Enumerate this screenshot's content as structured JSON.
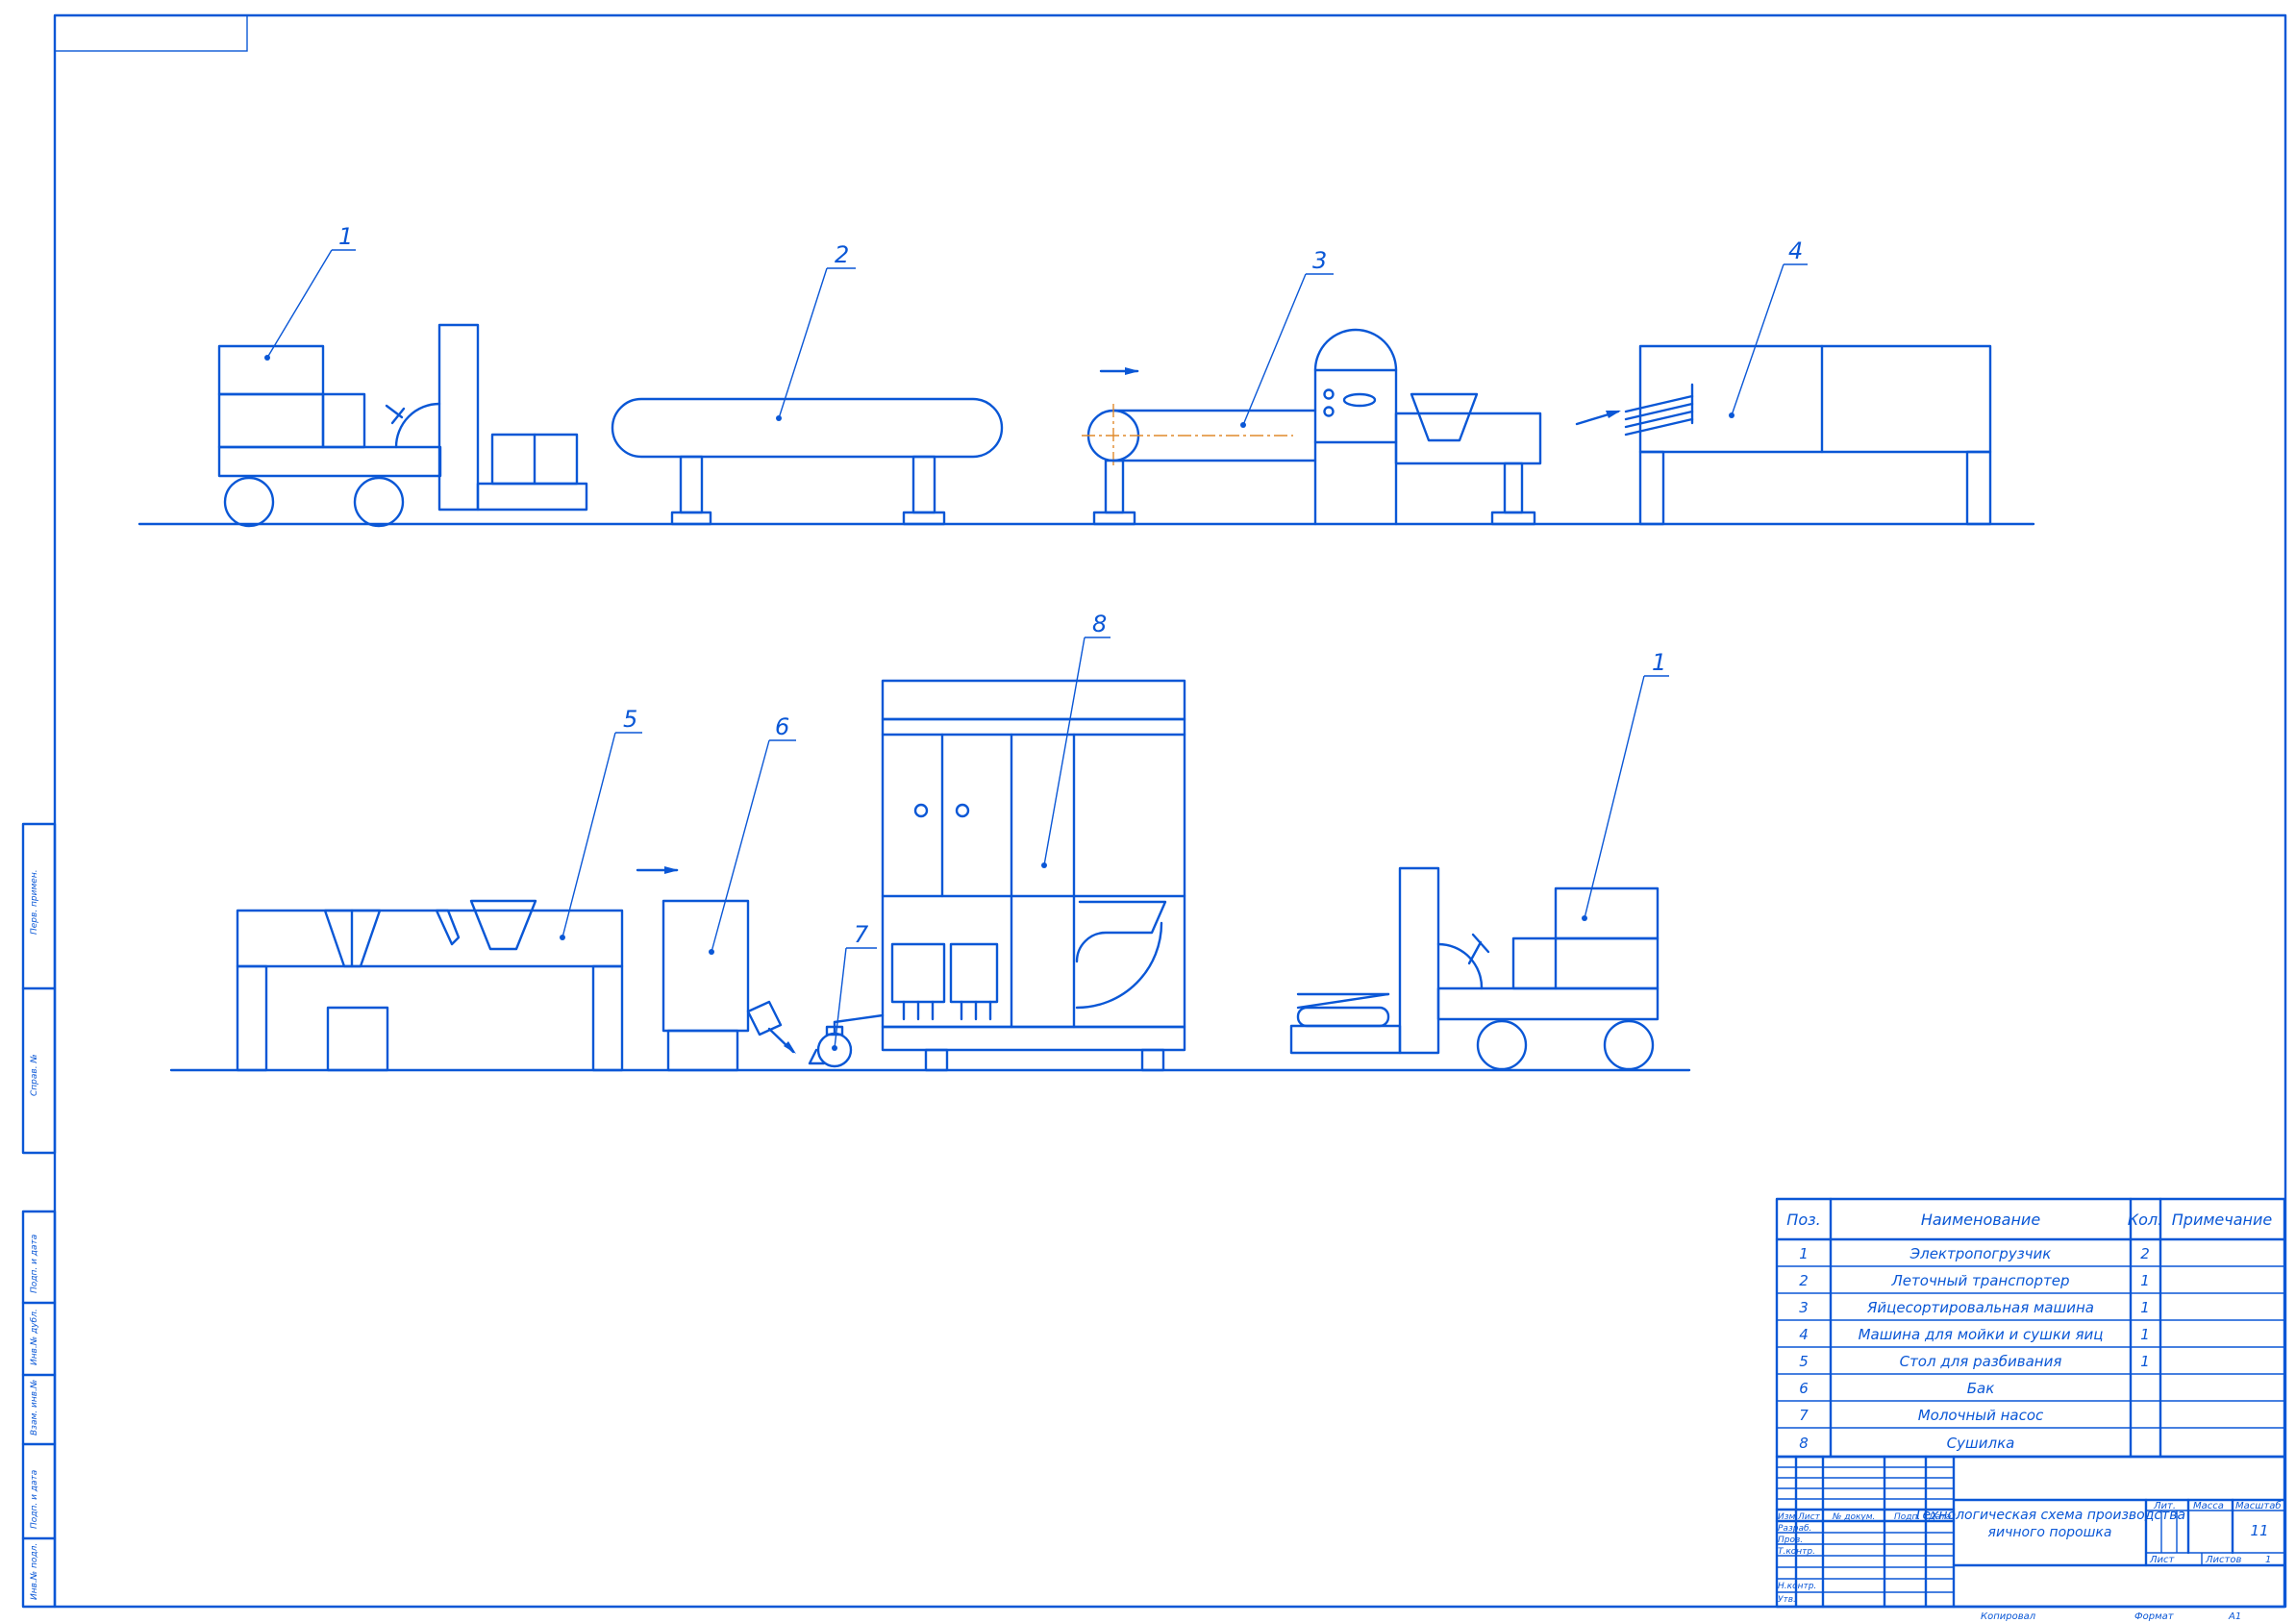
{
  "positions": [
    "1",
    "2",
    "3",
    "4",
    "5",
    "6",
    "7",
    "8"
  ],
  "spec": {
    "headers": {
      "pos": "Поз.",
      "name": "Наименование",
      "qty": "Кол.",
      "note": "Примечание"
    },
    "rows": [
      {
        "pos": "1",
        "name": "Электропогрузчик",
        "qty": "2"
      },
      {
        "pos": "2",
        "name": "Леточный транспортер",
        "qty": "1"
      },
      {
        "pos": "3",
        "name": "Яйцесортировальная машина",
        "qty": "1"
      },
      {
        "pos": "4",
        "name": "Машина для мойки и сушки яиц",
        "qty": "1"
      },
      {
        "pos": "5",
        "name": "Стол для разбивания",
        "qty": "1"
      },
      {
        "pos": "6",
        "name": "Бак",
        "qty": ""
      },
      {
        "pos": "7",
        "name": "Молочный насос",
        "qty": ""
      },
      {
        "pos": "8",
        "name": "Сушилка",
        "qty": ""
      }
    ]
  },
  "title_block": {
    "title_line1": "Технологическая схема производства",
    "title_line2": "яичного порошка",
    "lit": "Лит.",
    "mass": "Масса",
    "scale": "Масштаб",
    "scale_value": "11",
    "sheet": "Лист",
    "sheets": "Листов",
    "sheets_value": "1",
    "col_headers": [
      "Изм.",
      "Лист",
      "№ докум.",
      "Подп.",
      "Дата"
    ],
    "roles": [
      "Разраб.",
      "Пров.",
      "Т.контр.",
      "",
      "Н.контр.",
      "Утв."
    ],
    "copied": "Копировал",
    "format_label": "Формат",
    "format_value": "А1"
  },
  "side_stamp": [
    "Перв. примен.",
    "Справ. №",
    "Подп. и дата",
    "Инв.№ дубл.",
    "Взам. инв.№",
    "Подп. и дата",
    "Инв.№ подл."
  ]
}
